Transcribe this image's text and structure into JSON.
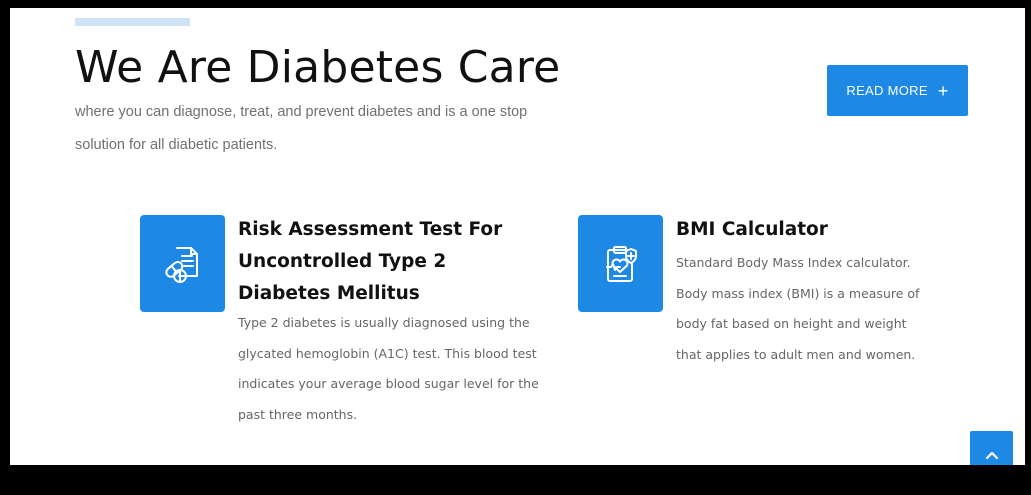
{
  "hero": {
    "title": "We Are Diabetes Care",
    "subtitle": "where you can diagnose, treat, and prevent diabetes and is a one stop solution for all diabetic patients.",
    "read_more_label": "READ MORE",
    "read_more_symbol": "+"
  },
  "services": [
    {
      "title": "Risk Assessment Test For Uncontrolled Type 2 Diabetes Mellitus",
      "description": "Type 2 diabetes is usually diagnosed using the glycated hemoglobin (A1C) test. This blood test indicates your average blood sugar level for the past three months.",
      "icon": "pills-document-icon"
    },
    {
      "title": "BMI Calculator",
      "description": "Standard Body Mass Index calculator. Body mass index (BMI) is a measure of body fat based on height and weight that applies to adult men and women.",
      "icon": "medical-clipboard-icon"
    }
  ],
  "scroll_top_icon": "chevron-up-icon",
  "colors": {
    "accent": "#1e88e5",
    "accent_light": "#cfe2f6",
    "heading": "#111111",
    "body_text": "#666666"
  }
}
